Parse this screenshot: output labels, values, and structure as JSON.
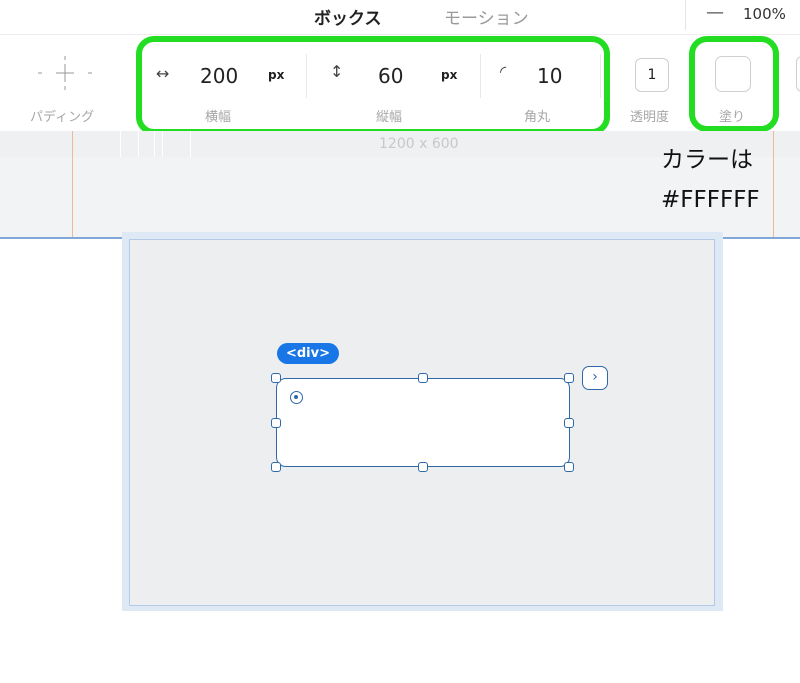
{
  "tabs": {
    "box": "ボックス",
    "motion": "モーション"
  },
  "zoom": {
    "minus_label": "—",
    "value": "100%"
  },
  "toolbar": {
    "padding_label": "パディング",
    "width": {
      "icon": "↔",
      "value": "200",
      "unit": "px",
      "label": "横幅"
    },
    "height": {
      "icon": "↕",
      "value": "60",
      "unit": "px",
      "label": "縦幅"
    },
    "radius": {
      "icon": "◜",
      "value": "10",
      "label": "角丸"
    },
    "opacity": {
      "value": "1",
      "label": "透明度"
    },
    "fill": {
      "label": "塗り",
      "color": "#FFFFFF"
    }
  },
  "canvas": {
    "size_label": "1200 x 600"
  },
  "annotation": {
    "line1": "カラーは",
    "line2": "#FFFFFF"
  },
  "element": {
    "tag": "<div>",
    "expand_icon": "›"
  },
  "colors": {
    "highlight": "#22dd22",
    "selection": "#2f68a8",
    "badge": "#1876e6"
  }
}
